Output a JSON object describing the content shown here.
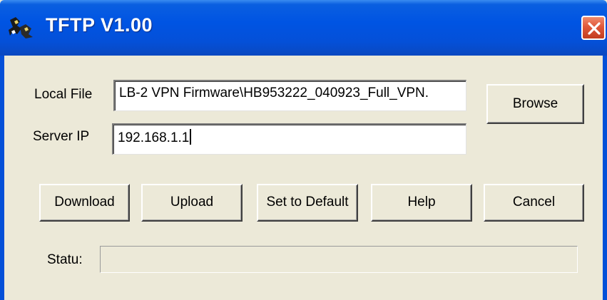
{
  "window": {
    "title": "TFTP V1.00",
    "icon": "tftp-app-icon",
    "close_icon": "close-icon",
    "accent": "#0054e3",
    "close_color": "#e0583a"
  },
  "form": {
    "local_file_label": "Local File",
    "local_file_value": "LB-2 VPN Firmware\\HB953222_040923_Full_VPN.",
    "server_ip_label": "Server IP",
    "server_ip_value": "192.168.1.1"
  },
  "buttons": {
    "browse": "Browse",
    "download": "Download",
    "upload": "Upload",
    "set_default": "Set to Default",
    "help": "Help",
    "cancel": "Cancel"
  },
  "status": {
    "label": "Statu:",
    "value": ""
  }
}
